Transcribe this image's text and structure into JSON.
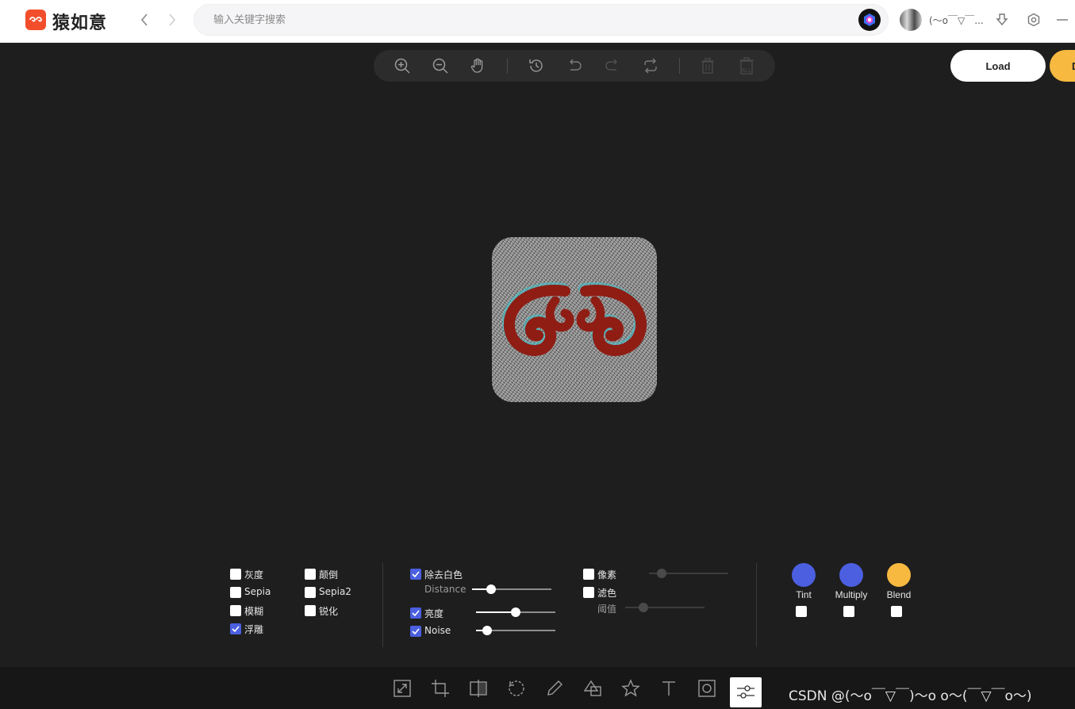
{
  "header": {
    "app_name": "猿如意",
    "search_placeholder": "输入关键字搜索",
    "username": "(～o￣▽￣...",
    "icons": [
      "logo-icon",
      "back-icon",
      "forward-icon",
      "app-icon",
      "avatar",
      "download-icon",
      "settings-icon",
      "minimize-icon"
    ]
  },
  "toolbar": {
    "icons": [
      "zoom-in-icon",
      "zoom-out-icon",
      "hand-icon",
      "history-icon",
      "undo-icon",
      "redo-icon",
      "reset-icon",
      "delete-icon",
      "delete-all-icon"
    ],
    "delete_all_text": "ALL"
  },
  "actions": {
    "load_label": "Load",
    "download_label": "D"
  },
  "filters": {
    "col1": [
      {
        "label": "灰度",
        "checked": false
      },
      {
        "label": "Sepia",
        "checked": false
      },
      {
        "label": "模糊",
        "checked": false
      },
      {
        "label": "浮雕",
        "checked": true
      }
    ],
    "col2": [
      {
        "label": "颠倒",
        "checked": false
      },
      {
        "label": "Sepia2",
        "checked": false
      },
      {
        "label": "锐化",
        "checked": false
      }
    ],
    "col3": {
      "remove_white": {
        "label": "除去白色",
        "checked": true
      },
      "distance_label": "Distance",
      "distance_value": 0.24,
      "brightness": {
        "label": "亮度",
        "checked": true,
        "value": 0.5
      },
      "noise": {
        "label": "Noise",
        "checked": true,
        "value": 0.14
      }
    },
    "col4": {
      "pixelate": {
        "label": "像素",
        "checked": false,
        "value": 0.16
      },
      "filter_color": {
        "label": "滤色",
        "checked": false
      },
      "threshold_label": "阈值",
      "threshold_value": 0.23
    },
    "blend": [
      {
        "label": "Tint",
        "color": "#4b5fe0",
        "checked": false
      },
      {
        "label": "Multiply",
        "color": "#4b5fe0",
        "checked": false
      },
      {
        "label": "Blend",
        "color": "#f7b940",
        "checked": false
      }
    ]
  },
  "bottom": {
    "icons": [
      "resize-icon",
      "crop-icon",
      "flip-icon",
      "rotate-icon",
      "pencil-icon",
      "shape-icon",
      "star-icon",
      "text-icon",
      "mask-icon",
      "filter-icon"
    ],
    "watermark": "CSDN @(～o￣▽￣)～o o～(￣▽￣o～)"
  },
  "colors": {
    "accent": "#4b5fe0",
    "brand": "#f24e2c",
    "yellow": "#f7b940",
    "canvas_bg": "#1e1e1e"
  }
}
